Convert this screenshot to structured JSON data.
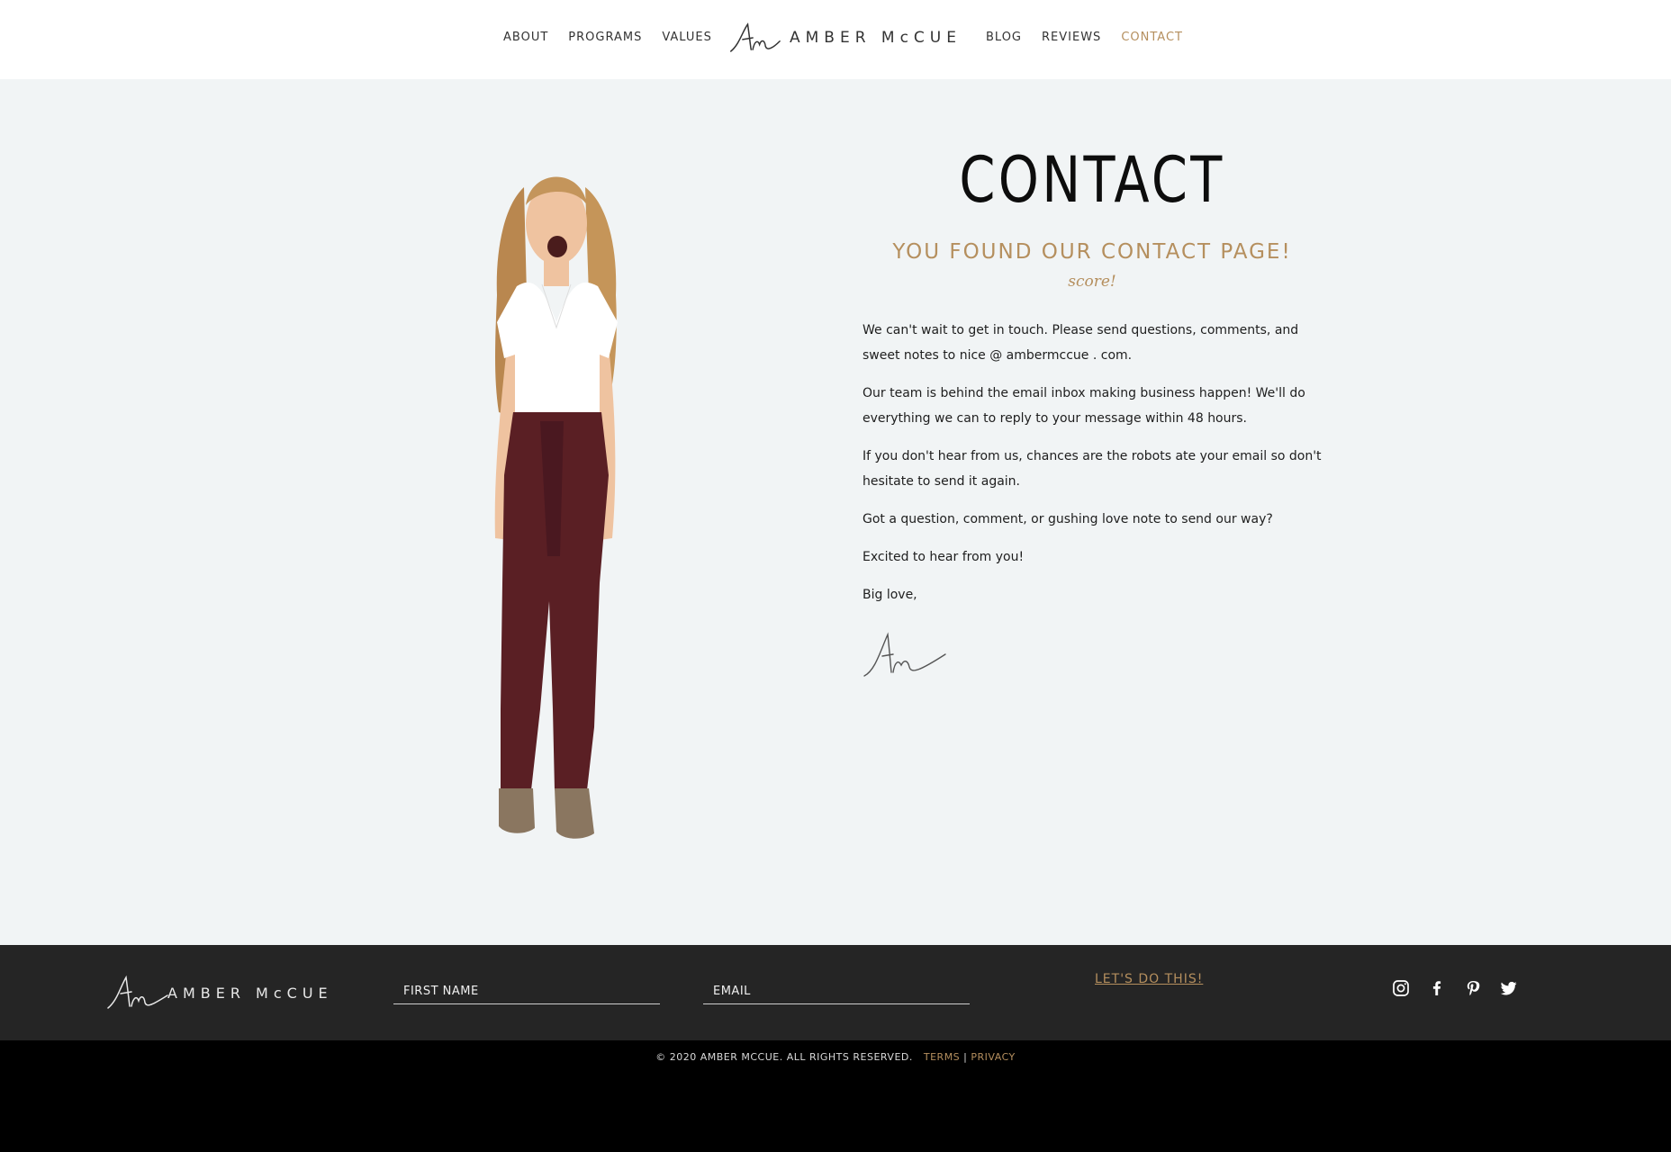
{
  "header": {
    "nav_left": [
      "ABOUT",
      "PROGRAMS",
      "VALUES"
    ],
    "nav_right": [
      "BLOG",
      "REVIEWS",
      "CONTACT"
    ],
    "active_item": "CONTACT",
    "logo_text": "AMBER McCUE"
  },
  "main": {
    "title": "CONTACT",
    "subtitle": "YOU FOUND OUR CONTACT PAGE!",
    "tagline": "score!",
    "paragraphs": [
      "We can't wait to get in touch. Please send questions, comments, and sweet notes to nice @ ambermccue . com.",
      "Our team is behind the email inbox making business happen! We'll do everything we can to reply to your message within 48 hours.",
      "If you don't hear from us, chances are the robots ate your email so don't hesitate to send it again.",
      "Got a question, comment, or gushing love note to send our way?",
      "Excited to hear from you!",
      "Big love,"
    ]
  },
  "footer": {
    "logo_text": "AMBER McCUE",
    "first_name_placeholder": "FIRST NAME",
    "email_placeholder": "EMAIL",
    "cta_label": "LET'S DO THIS!",
    "social": [
      "instagram-icon",
      "facebook-icon",
      "pinterest-icon",
      "twitter-icon"
    ]
  },
  "bottom": {
    "copyright": "© 2020 AMBER MCCUE. ALL RIGHTS RESERVED.",
    "terms": "TERMS",
    "separator": "|",
    "privacy": "PRIVACY"
  },
  "colors": {
    "accent": "#b58f5e",
    "main_bg": "#f1f4f5",
    "footer_bg": "#252525",
    "bottom_bg": "#000000"
  }
}
